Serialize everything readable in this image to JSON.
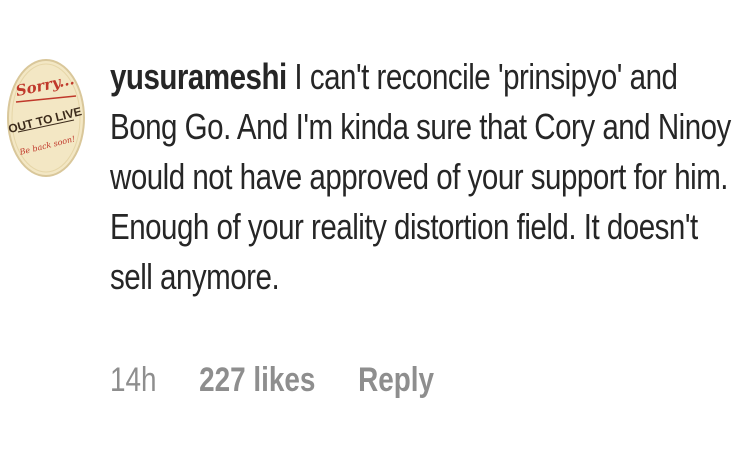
{
  "comment": {
    "avatar": {
      "icon": "sorry-out-to-live-badge-icon",
      "lettering": [
        "Sorry...",
        "OUT TO LIVE",
        "Be back soon!"
      ],
      "colors": {
        "background": "#f3e7c4",
        "ring": "#d9c79a",
        "red": "#c0392b",
        "dark": "#3b2a1a"
      }
    },
    "username": "yusurameshi",
    "text": "I can't reconcile 'prinsipyo' and Bong Go. And I'm kinda sure that Cory and Ninoy would not have approved of your support for him. Enough of your reality distortion field. It doesn't sell anymore.",
    "timestamp": "14h",
    "likes": "227 likes",
    "reply_label": "Reply"
  }
}
